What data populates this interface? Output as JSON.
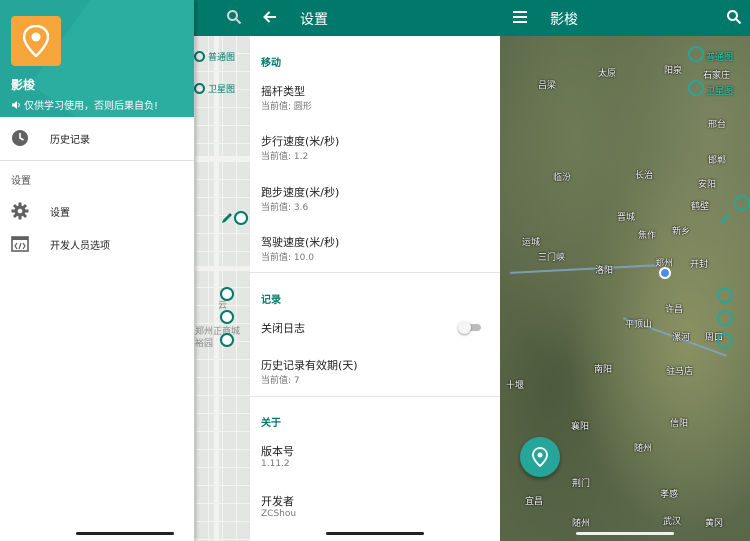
{
  "panel1": {
    "map_labels": {
      "normal_map": "普通图",
      "satellite_map": "卫星图",
      "street1": "郑州正商城",
      "street2": "裕园",
      "street3": "云"
    },
    "drawer": {
      "app_name": "影梭",
      "subtitle": "仅供学习使用，否则后果自负!",
      "history": "历史记录",
      "settings_section": "设置",
      "settings": "设置",
      "developer": "开发人员选项"
    }
  },
  "panel2": {
    "title": "设置",
    "cat_move": "移动",
    "joystick": {
      "title": "摇杆类型",
      "summary": "当前值: 圆形"
    },
    "walk": {
      "title": "步行速度(米/秒)",
      "summary": "当前值: 1.2"
    },
    "run": {
      "title": "跑步速度(米/秒)",
      "summary": "当前值: 3.6"
    },
    "drive": {
      "title": "驾驶速度(米/秒)",
      "summary": "当前值: 10.0"
    },
    "cat_log": "记录",
    "close_log": {
      "title": "关闭日志"
    },
    "history_days": {
      "title": "历史记录有效期(天)",
      "summary": "当前值: 7"
    },
    "cat_about": "关于",
    "version": {
      "title": "版本号",
      "summary": "1.11.2"
    },
    "developer": {
      "title": "开发者",
      "summary": "ZCShou"
    }
  },
  "panel3": {
    "title": "影梭",
    "normal_map": "普通图",
    "satellite_map": "卫星图",
    "cities": [
      "吕梁",
      "太原",
      "阳泉",
      "石家庄",
      "邢台",
      "邯郸",
      "安阳",
      "鹤壁",
      "新乡",
      "长治",
      "临汾",
      "晋城",
      "焦作",
      "运城",
      "三门峡",
      "洛阳",
      "郑州",
      "开封",
      "许昌",
      "平顶山",
      "漯河",
      "周口",
      "南阳",
      "驻马店",
      "十堰",
      "襄阳",
      "信阳",
      "随州",
      "孝感",
      "荆门",
      "宜昌",
      "武汉",
      "黄冈",
      "随州"
    ]
  }
}
